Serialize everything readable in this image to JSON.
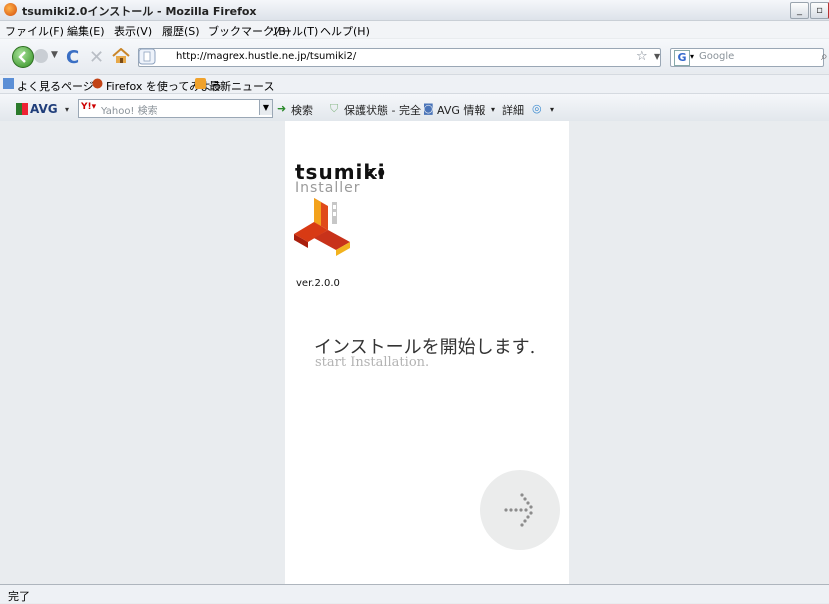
{
  "window": {
    "title": "tsumiki2.0インストール - Mozilla Firefox"
  },
  "menu": [
    "ファイル(F)",
    "編集(E)",
    "表示(V)",
    "履歴(S)",
    "ブックマーク(B)",
    "ツール(T)",
    "ヘルプ(H)"
  ],
  "nav": {
    "url": "http://magrex.hustle.ne.jp/tsumiki2/",
    "search_placeholder": "Google"
  },
  "bookmarks": [
    "よく見るページ",
    "Firefox を使ってみよう",
    "最新ニュース"
  ],
  "avg": {
    "logo": "AVG",
    "yahoo_placeholder": "Yahoo! 検索",
    "search_label": "検索",
    "status_label": "保護状態 - 完全",
    "info_label": "AVG 情報",
    "details_label": "詳細"
  },
  "page": {
    "logo_word": "tsumiki",
    "logo_version": "2.0",
    "logo_sub": "Installer",
    "version": "ver.2.0.0",
    "heading_jp": "インストールを開始します.",
    "heading_en": "start Installation."
  },
  "status": "完了"
}
